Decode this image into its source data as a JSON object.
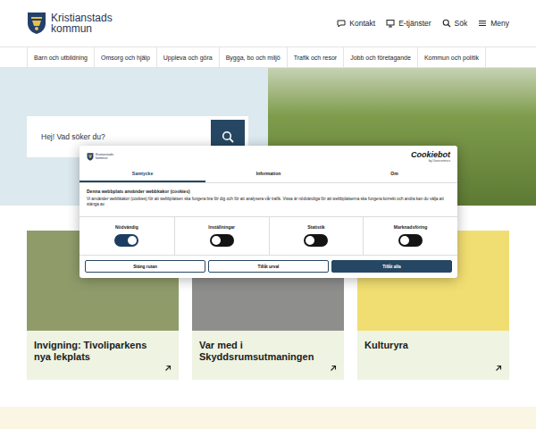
{
  "header": {
    "logo": {
      "line1": "Kristianstads",
      "line2": "kommun"
    },
    "links": [
      {
        "label": "Kontakt",
        "kind": "contact"
      },
      {
        "label": "E-tjänster",
        "kind": "services"
      },
      {
        "label": "Sök",
        "kind": "search"
      },
      {
        "label": "Meny",
        "kind": "menu"
      }
    ]
  },
  "nav": [
    "Barn och utbildning",
    "Omsorg och hjälp",
    "Uppleva och göra",
    "Bygga, bo och miljö",
    "Trafik och resor",
    "Jobb och företagande",
    "Kommun och politik"
  ],
  "search": {
    "placeholder": "Hej! Vad söker du?"
  },
  "cards": [
    {
      "title": "Invigning: Tivoliparkens nya lekplats",
      "color": "#8f9c6a"
    },
    {
      "title": "Var med i Skyddsrumsutmaningen",
      "color": "#8e8f8c"
    },
    {
      "title": "Kulturyra",
      "color": "#f1de72"
    }
  ],
  "cookie_dialog": {
    "logo": {
      "line1": "Kristianstads",
      "line2": "kommun"
    },
    "brand": "Cookiebot",
    "brand_sub": "by Usercentrics",
    "tabs": [
      {
        "label": "Samtycke",
        "selected": true
      },
      {
        "label": "Information",
        "selected": false
      },
      {
        "label": "Om",
        "selected": false
      }
    ],
    "heading": "Denna webbplats använder webbkakor (cookies)",
    "body": "Vi använder webbkakor (cookies) för att webbplatsen ska fungera bra för dig och för att analysera vår trafik. Vissa är nödvändiga för att webbplatserna ska fungera korrekt och andra kan du välja att stänga av.",
    "toggles": [
      {
        "label": "Nödvändig",
        "on": true
      },
      {
        "label": "Inställningar",
        "on": false
      },
      {
        "label": "Statistik",
        "on": false
      },
      {
        "label": "Marknadsföring",
        "on": false
      }
    ],
    "buttons": [
      {
        "label": "Stäng rutan",
        "kind": "outline"
      },
      {
        "label": "Tillåt urval",
        "kind": "outline"
      },
      {
        "label": "Tillåt alla",
        "kind": "filled"
      }
    ]
  }
}
